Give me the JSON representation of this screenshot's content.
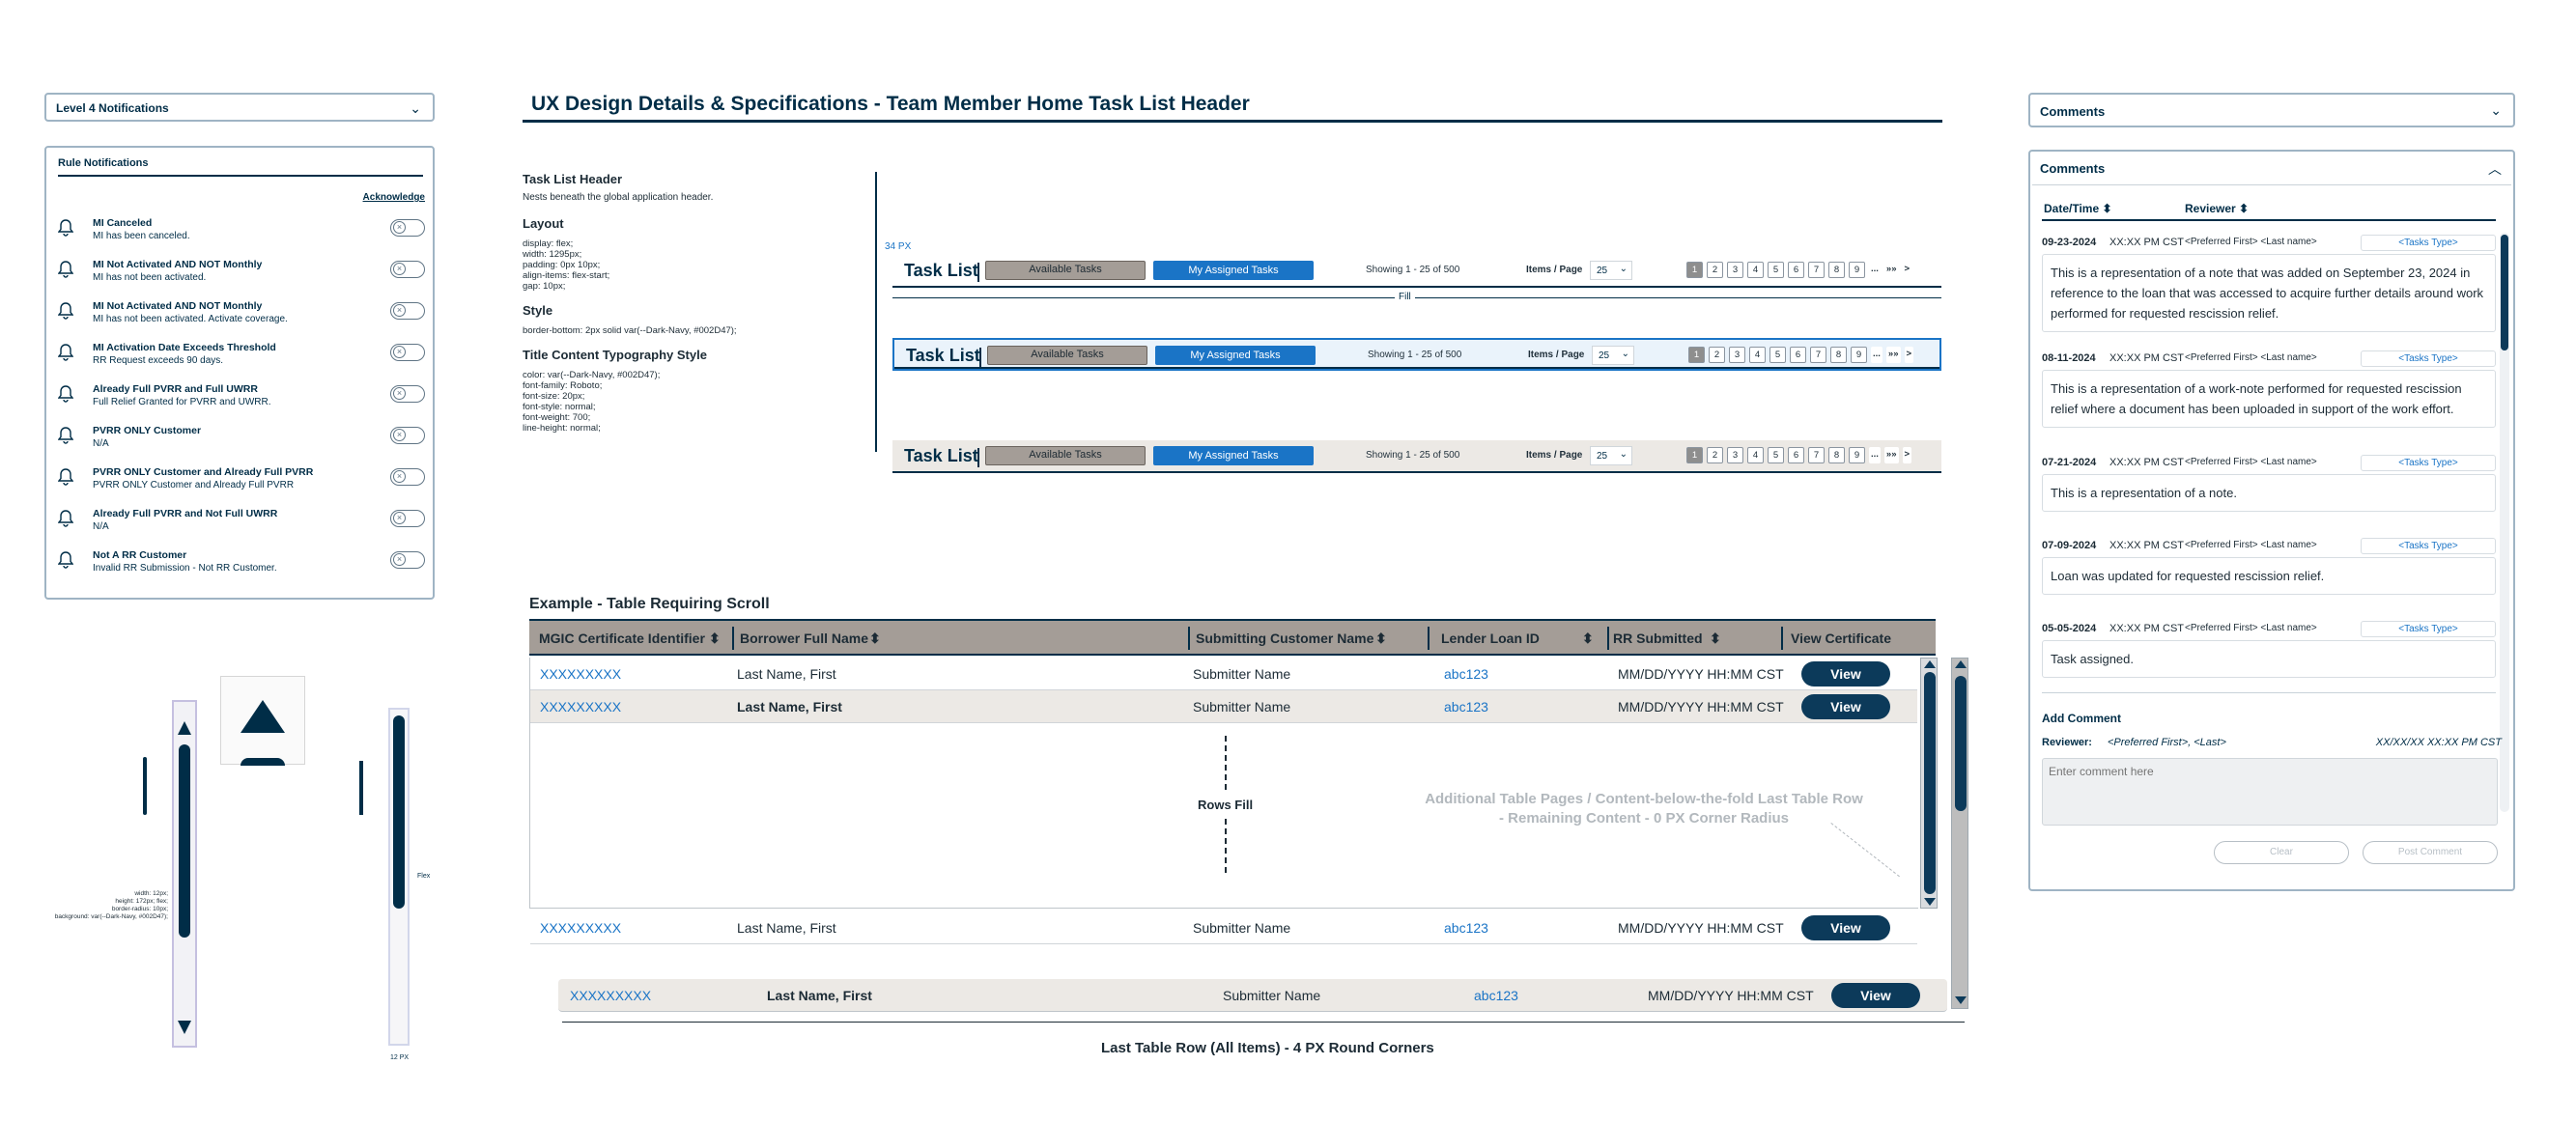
{
  "left_panel": {
    "level_notifications": "Level 4 Notifications",
    "rule_title": "Rule Notifications",
    "acknowledge": "Acknowledge",
    "rules": [
      {
        "title": "MI Canceled",
        "sub": "MI has been canceled."
      },
      {
        "title": "MI Not Activated AND NOT Monthly",
        "sub": "MI has not been activated."
      },
      {
        "title": "MI Not Activated AND NOT Monthly",
        "sub": "MI has not been activated. Activate coverage."
      },
      {
        "title": "MI Activation Date Exceeds Threshold",
        "sub": "RR Request exceeds 90 days."
      },
      {
        "title": "Already Full PVRR and Full UWRR",
        "sub": "Full Relief Granted for PVRR and UWRR."
      },
      {
        "title": "PVRR ONLY Customer",
        "sub": "N/A"
      },
      {
        "title": "PVRR ONLY Customer and Already Full PVRR",
        "sub": "PVRR ONLY Customer and Already Full PVRR"
      },
      {
        "title": "Already Full PVRR and Not Full UWRR",
        "sub": "N/A"
      },
      {
        "title": "Not A RR Customer",
        "sub": "Invalid RR Submission - Not RR Customer."
      }
    ],
    "scroll_spec": [
      "width: 12px;",
      "height: 172px; flex;",
      "border-radius: 10px;",
      "background: var(--Dark-Navy, #002D47);"
    ],
    "scroll_dim_right": "Flex",
    "scroll_dim_bottom_a": "12 PX"
  },
  "center": {
    "page_title": "UX Design Details & Specifications - Team Member Home Task List Header",
    "spec": {
      "h1": "Task List Header",
      "p1": "Nests beneath the global application header.",
      "h2": "Layout",
      "layout_lines": [
        "display: flex;",
        "width: 1295px;",
        "padding: 0px 10px;",
        "align-items: flex-start;",
        "gap: 10px;"
      ],
      "h3": "Style",
      "style_line": "border-bottom: 2px solid var(--Dark-Navy, #002D47);",
      "h4": "Title Content Typography Style",
      "type_lines": [
        "color: var(--Dark-Navy, #002D47);",
        "font-family: Roboto;",
        "font-size: 20px;",
        "font-style: normal;",
        "font-weight: 700;",
        "line-height: normal;"
      ]
    },
    "px_note": "34 PX",
    "fill_label": "Fill",
    "task_list": {
      "title": "Task List",
      "available": "Available Tasks",
      "mine": "My Assigned Tasks",
      "showing": "Showing   1 - 25  of  500",
      "items_per_page": "Items / Page",
      "ipp_value": "25",
      "pages": [
        "1",
        "2",
        "3",
        "4",
        "5",
        "6",
        "7",
        "8",
        "9",
        "...",
        "»»",
        ">"
      ]
    },
    "table": {
      "caption": "Example - Table Requiring Scroll",
      "headers": [
        "MGIC Certificate Identifier",
        "Borrower Full Name",
        "Submitting Customer Name",
        "Lender Loan ID",
        "RR Submitted",
        "View Certificate"
      ],
      "rows": [
        {
          "id": "XXXXXXXXX",
          "name": "Last Name, First",
          "sub": "Submitter Name",
          "loan": "abc123",
          "date": "MM/DD/YYYY HH:MM CST",
          "btn": "View"
        },
        {
          "id": "XXXXXXXXX",
          "name": "Last Name, First",
          "sub": "Submitter Name",
          "loan": "abc123",
          "date": "MM/DD/YYYY HH:MM CST",
          "btn": "View"
        },
        {
          "id": "XXXXXXXXX",
          "name": "Last Name, First",
          "sub": "Submitter Name",
          "loan": "abc123",
          "date": "MM/DD/YYYY HH:MM CST",
          "btn": "View"
        },
        {
          "id": "XXXXXXXXX",
          "name": "Last Name, First",
          "sub": "Submitter Name",
          "loan": "abc123",
          "date": "MM/DD/YYYY HH:MM CST",
          "btn": "View"
        }
      ],
      "rows_fill": "Rows Fill",
      "note_line1": "Additional Table Pages / Content-below-the-fold Last Table Row",
      "note_line2": "- Remaining Content - 0 PX  Corner Radius",
      "last_row_label": "Last Table Row (All Items) - 4 PX Round Corners"
    }
  },
  "right_panel": {
    "comments_collapsed": "Comments",
    "comments_title": "Comments",
    "col_date": "Date/Time",
    "col_reviewer": "Reviewer",
    "entries": [
      {
        "date": "09-23-2024",
        "time": "XX:XX PM CST",
        "reviewer": "<Preferred First> <Last name>",
        "type": "<Tasks Type>",
        "text": "This is a representation of a note that was added on September 23, 2024 in reference to the loan that was accessed to acquire further details around work performed for requested rescission relief."
      },
      {
        "date": "08-11-2024",
        "time": "XX:XX PM CST",
        "reviewer": "<Preferred First> <Last name>",
        "type": "<Tasks Type>",
        "text": "This is a representation of a work-note performed for requested rescission relief where a document has been uploaded in support of the work effort."
      },
      {
        "date": "07-21-2024",
        "time": "XX:XX PM CST",
        "reviewer": "<Preferred First> <Last name>",
        "type": "<Tasks Type>",
        "text": "This is a representation of a note."
      },
      {
        "date": "07-09-2024",
        "time": "XX:XX PM CST",
        "reviewer": "<Preferred First> <Last name>",
        "type": "<Tasks Type>",
        "text": "Loan was updated for requested rescission relief."
      },
      {
        "date": "05-05-2024",
        "time": "XX:XX PM CST",
        "reviewer": "<Preferred First> <Last name>",
        "type": "<Tasks Type>",
        "text": "Task assigned."
      }
    ],
    "add_comment": "Add Comment",
    "reviewer_label": "Reviewer:",
    "reviewer_value": "<Preferred First>, <Last>",
    "reviewer_time": "XX/XX/XX XX:XX PM CST",
    "placeholder": "Enter comment here",
    "clear": "Clear",
    "post": "Post Comment"
  }
}
